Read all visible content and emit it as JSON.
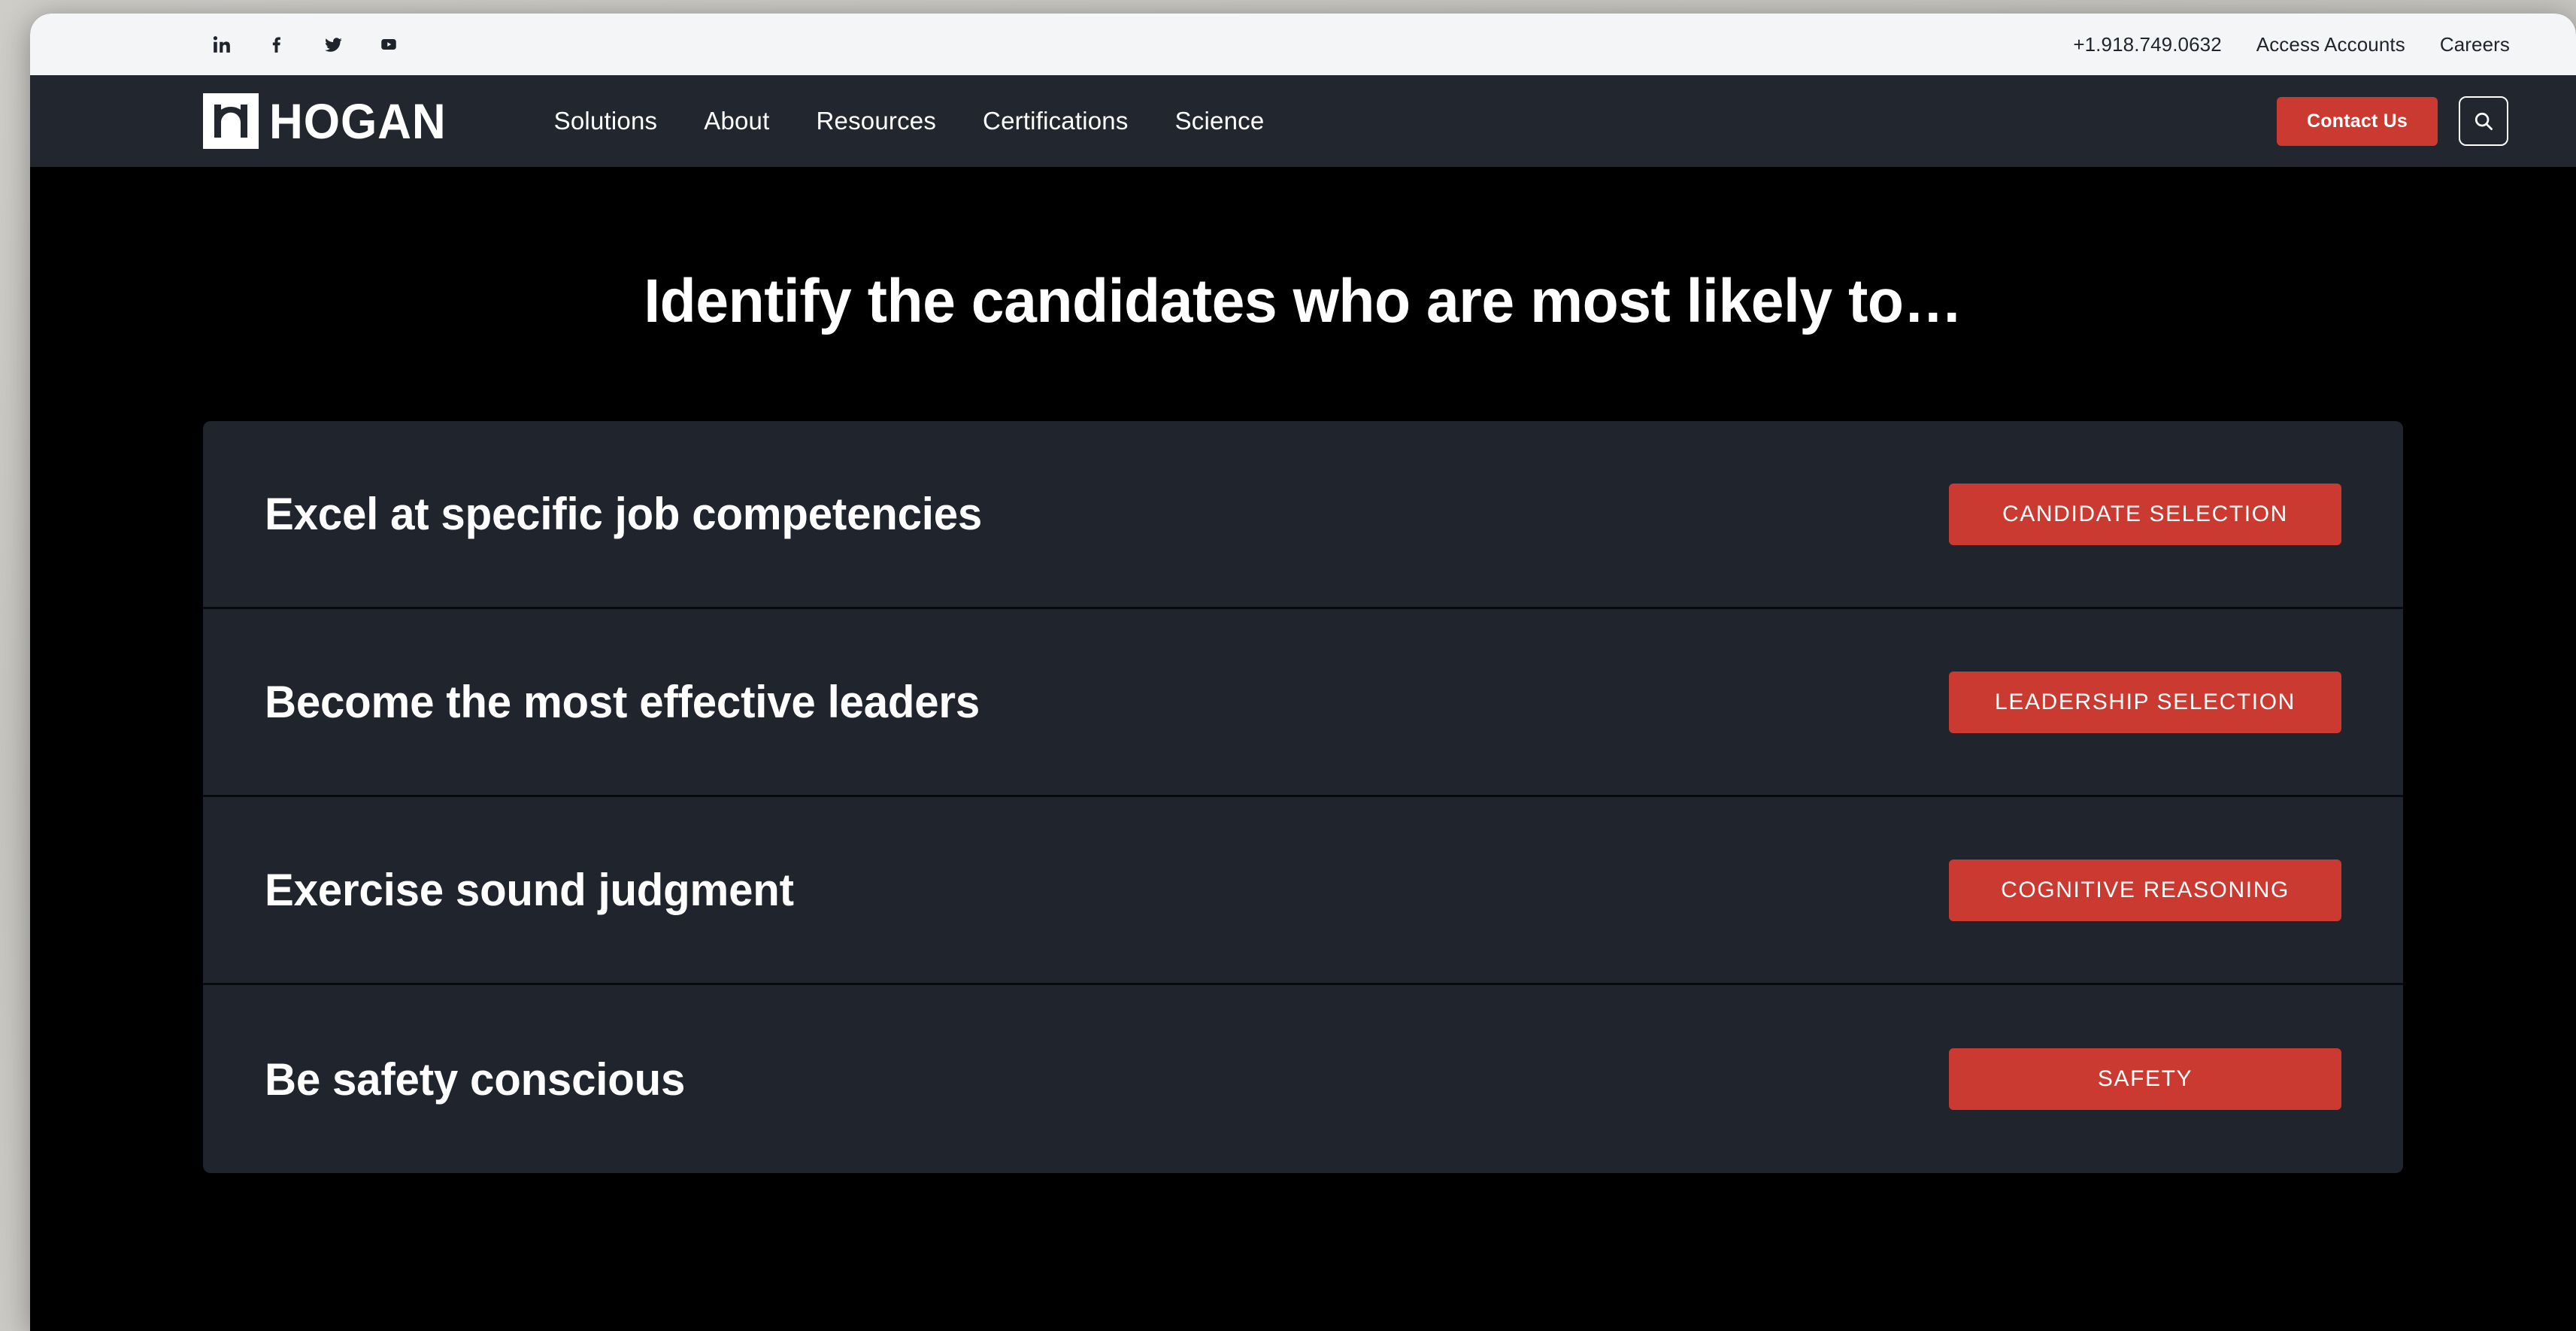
{
  "colors": {
    "page_background": "#000000",
    "header_background": "#22262f",
    "utility_background": "#f4f5f7",
    "card_background": "#20242c",
    "accent_red": "#cb3a30",
    "text_light": "#ffffff"
  },
  "utility_bar": {
    "social": [
      {
        "name": "linkedin-icon",
        "label": "LinkedIn"
      },
      {
        "name": "facebook-icon",
        "label": "Facebook"
      },
      {
        "name": "twitter-icon",
        "label": "Twitter"
      },
      {
        "name": "youtube-icon",
        "label": "YouTube"
      }
    ],
    "links": [
      {
        "label": "+1.918.749.0632"
      },
      {
        "label": "Access Accounts"
      },
      {
        "label": "Careers"
      }
    ]
  },
  "header": {
    "brand_word": "HOGAN",
    "brand_mark": "hogan-arch-logo",
    "nav": [
      {
        "label": "Solutions"
      },
      {
        "label": "About"
      },
      {
        "label": "Resources"
      },
      {
        "label": "Certifications"
      },
      {
        "label": "Science"
      }
    ],
    "contact_label": "Contact Us",
    "search_icon": "search-icon"
  },
  "main": {
    "heading": "Identify the candidates who are most likely to…",
    "rows": [
      {
        "title": "Excel at specific job competencies",
        "button": "CANDIDATE SELECTION"
      },
      {
        "title": "Become the most effective leaders",
        "button": "LEADERSHIP SELECTION"
      },
      {
        "title": "Exercise sound judgment",
        "button": "COGNITIVE REASONING"
      },
      {
        "title": "Be safety conscious",
        "button": "SAFETY"
      }
    ]
  }
}
